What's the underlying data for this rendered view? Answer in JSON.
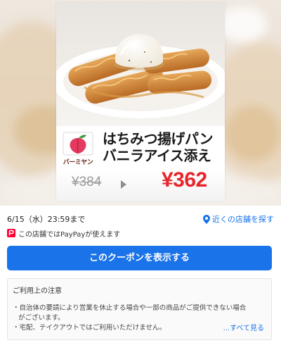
{
  "coupon": {
    "title_line1": "はちみつ揚げパン",
    "title_line2": "バニラアイス添え",
    "brand_logo_text": "バーミヤン",
    "old_price": "¥384",
    "new_price": "¥362"
  },
  "info": {
    "deadline": "6/15（水）23:59まで",
    "nearby_label": "近くの店舗を探す",
    "paypay_text": "この店舗ではPayPayが使えます"
  },
  "actions": {
    "show_coupon_label": "このクーポンを表示する"
  },
  "notice": {
    "title": "ご利用上の注意",
    "line1": "・自治体の要請により営業を休止する場合や一部の商品がご提供できない場合",
    "line2": "がございます。",
    "line3": "・宅配、テイクアウトではご利用いただけません。",
    "see_all_label": "...すべて見る"
  },
  "colors": {
    "accent_blue": "#1a73e8",
    "price_red": "#e8252a",
    "paypay_red": "#ff0033",
    "brand_peach": "#e43a5f"
  },
  "icons": [
    "arrow-right-icon",
    "map-pin-icon",
    "paypay-icon",
    "peach-logo-icon"
  ]
}
